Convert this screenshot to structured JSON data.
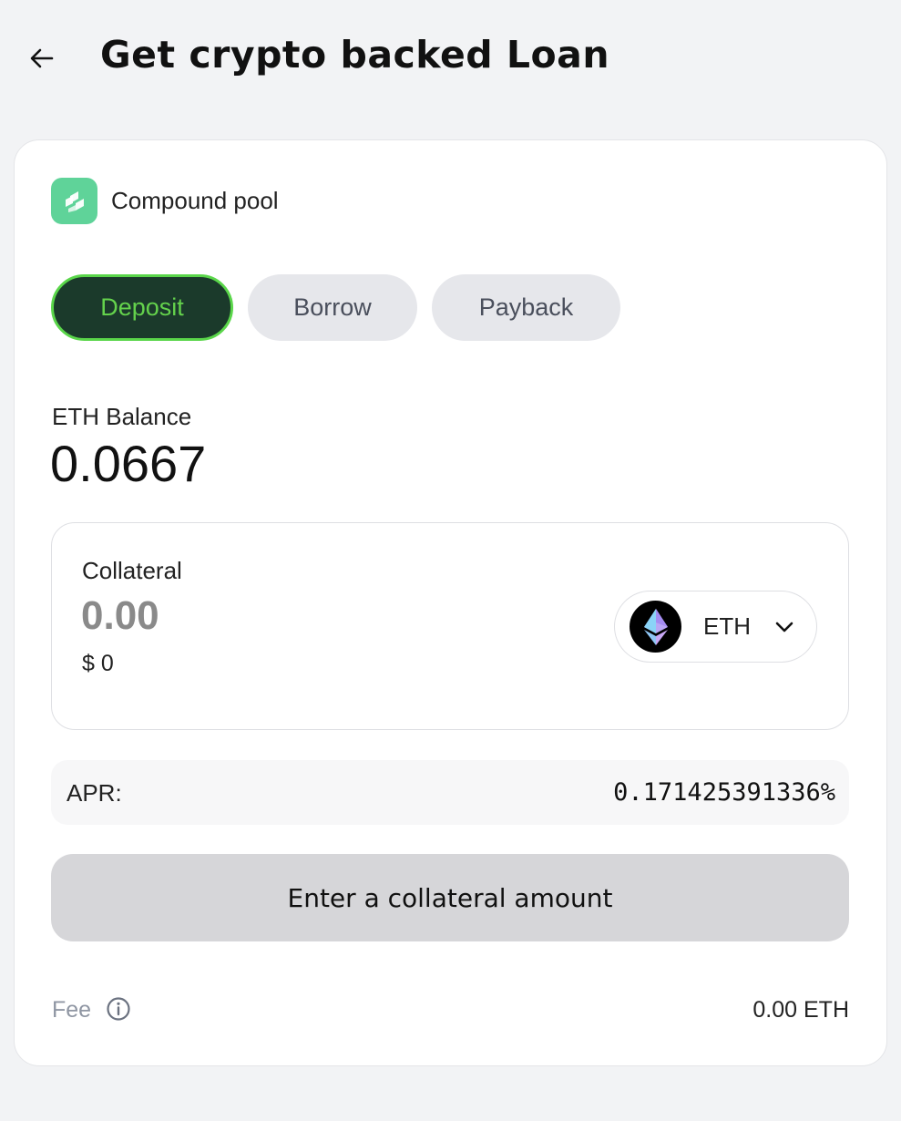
{
  "header": {
    "title": "Get crypto backed Loan",
    "back_icon": "arrow-left-icon"
  },
  "pool": {
    "name": "Compound pool",
    "logo_icon": "compound-logo-icon",
    "logo_color": "#5fd399"
  },
  "tabs": [
    {
      "label": "Deposit",
      "active": true
    },
    {
      "label": "Borrow",
      "active": false
    },
    {
      "label": "Payback",
      "active": false
    }
  ],
  "balance": {
    "label": "ETH Balance",
    "value": "0.0667"
  },
  "collateral": {
    "label": "Collateral",
    "placeholder": "0.00",
    "usd_value": "$ 0",
    "token": {
      "symbol": "ETH",
      "icon": "ethereum-icon"
    }
  },
  "apr": {
    "label": "APR:",
    "value": "0.171425391336%"
  },
  "submit": {
    "label": "Enter a collateral amount"
  },
  "fee": {
    "label": "Fee",
    "value": "0.00 ETH",
    "info_icon": "info-icon"
  },
  "colors": {
    "active_tab_bg": "#1b3a2b",
    "active_tab_text": "#64d24c",
    "page_bg": "#f2f3f5"
  }
}
